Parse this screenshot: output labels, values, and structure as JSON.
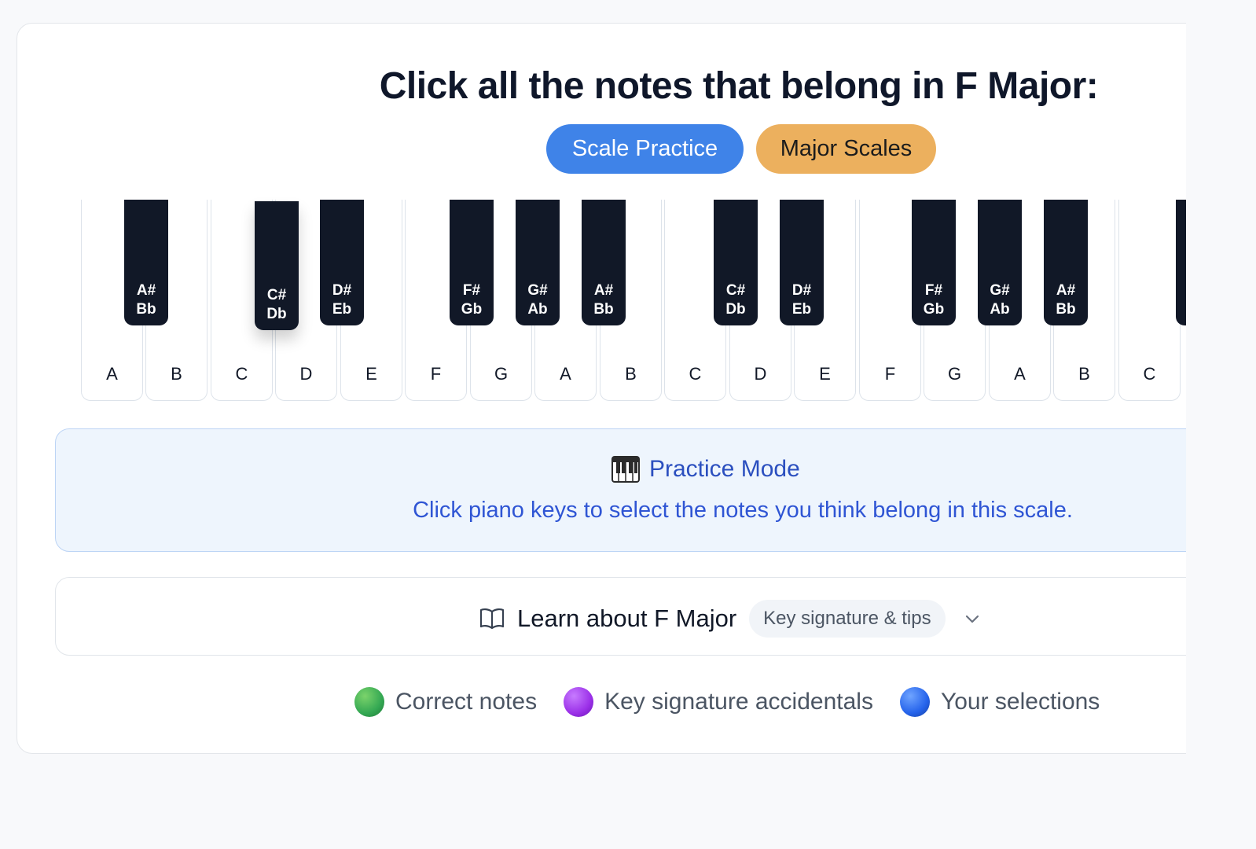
{
  "header": {
    "title": "Click all the notes that belong in F Major:",
    "tag_mode": "Scale Practice",
    "tag_category": "Major Scales"
  },
  "piano": {
    "white_keys": [
      "A",
      "B",
      "C",
      "D",
      "E",
      "F",
      "G",
      "A",
      "B",
      "C",
      "D",
      "E",
      "F",
      "G",
      "A",
      "B",
      "C"
    ],
    "black_keys": [
      {
        "sharp": "A#",
        "flat": "Bb"
      },
      {
        "sharp": "C#",
        "flat": "Db"
      },
      {
        "sharp": "D#",
        "flat": "Eb"
      },
      {
        "sharp": "F#",
        "flat": "Gb"
      },
      {
        "sharp": "G#",
        "flat": "Ab"
      },
      {
        "sharp": "A#",
        "flat": "Bb"
      },
      {
        "sharp": "C#",
        "flat": "Db"
      },
      {
        "sharp": "D#",
        "flat": "Eb"
      },
      {
        "sharp": "F#",
        "flat": "Gb"
      },
      {
        "sharp": "G#",
        "flat": "Ab"
      },
      {
        "sharp": "A#",
        "flat": "Bb"
      },
      {
        "sharp": "",
        "flat": ""
      }
    ]
  },
  "practice": {
    "icon": "piano-icon",
    "title": "Practice Mode",
    "text": "Click piano keys to select the notes you think belong in this scale."
  },
  "learn": {
    "icon": "book-open-icon",
    "title": "Learn about F Major",
    "badge": "Key signature & tips",
    "toggle_icon": "chevron-down-icon"
  },
  "legend": [
    {
      "label": "Correct notes",
      "color": "#34a853"
    },
    {
      "label": "Key signature accidentals",
      "color": "#9b30e8"
    },
    {
      "label": "Your selections",
      "color": "#2563eb"
    }
  ],
  "colors": {
    "accent_blue": "#3f83e8",
    "accent_orange": "#ecb05e",
    "practice_bg": "#eef5fd",
    "practice_text": "#2f55d4"
  }
}
